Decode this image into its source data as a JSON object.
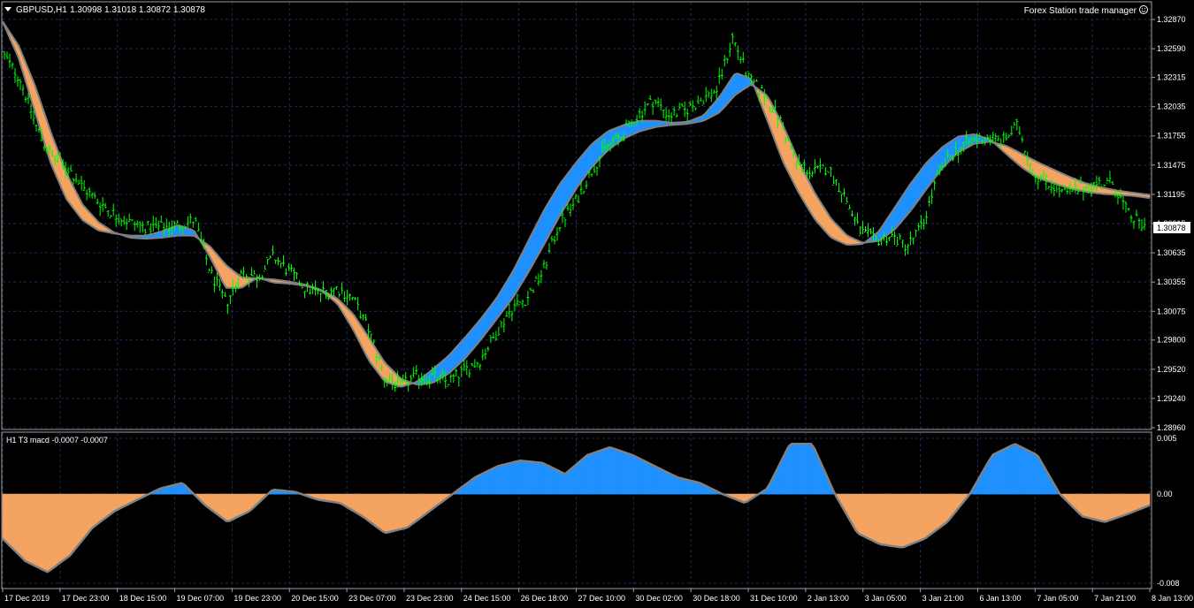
{
  "header": {
    "symbol": "GBPUSD,H1",
    "ohlc": "1.30998 1.31018 1.30872 1.30878",
    "trade_manager": "Forex Station trade manager"
  },
  "colors": {
    "background": "#000000",
    "candle": "#00ff00",
    "up_fill": "#1e90ff",
    "down_fill": "#f4a460",
    "line": "#808080",
    "grid": "#1e2a5a",
    "price_label_bg": "#ffffff"
  },
  "icons": {
    "menu": "triangle-down-icon",
    "trade_manager": "smiley-icon"
  },
  "chart_data": [
    {
      "type": "line",
      "panel": "price",
      "ylim": [
        1.2896,
        1.3287
      ],
      "yticks": [
        "1.32870",
        "1.32590",
        "1.32315",
        "1.32035",
        "1.31755",
        "1.31475",
        "1.31195",
        "1.30915",
        "1.30635",
        "1.30355",
        "1.30075",
        "1.29800",
        "1.29520",
        "1.29240",
        "1.28960"
      ],
      "current_price": "1.30878",
      "grid": true,
      "series": [
        {
          "values": [
            1.3252,
            1.323,
            1.3185,
            1.3155,
            1.3145,
            1.3125,
            1.3112,
            1.31,
            1.3092,
            1.3088,
            1.3088,
            1.309,
            1.3095,
            1.3045,
            1.3015,
            1.3045,
            1.304,
            1.306,
            1.3045,
            1.303,
            1.3025,
            1.303,
            1.302,
            1.299,
            1.2945,
            1.2935,
            1.2945,
            1.2945,
            1.294,
            1.295,
            1.296,
            1.2985,
            1.301,
            1.302,
            1.3045,
            1.309,
            1.311,
            1.314,
            1.3165,
            1.3175,
            1.3195,
            1.321,
            1.3195,
            1.32,
            1.321,
            1.322,
            1.327,
            1.323,
            1.3215,
            1.319,
            1.315,
            1.314,
            1.3145,
            1.312,
            1.3085,
            1.3075,
            1.308,
            1.307,
            1.309,
            1.314,
            1.316,
            1.317,
            1.3175,
            1.317,
            1.3185,
            1.314,
            1.313,
            1.312,
            1.3125,
            1.313,
            1.313,
            1.31,
            1.3088
          ]
        }
      ],
      "band_fast": [
        1.3285,
        1.325,
        1.32,
        1.315,
        1.3115,
        1.3095,
        1.3085,
        1.3082,
        1.308,
        1.308,
        1.3084,
        1.309,
        1.3085,
        1.306,
        1.303,
        1.303,
        1.304,
        1.3035,
        1.3034,
        1.3032,
        1.3027,
        1.3015,
        1.299,
        1.296,
        1.294,
        1.2935,
        1.294,
        1.2952,
        1.2965,
        1.2982,
        1.3,
        1.302,
        1.3045,
        1.3075,
        1.3105,
        1.313,
        1.315,
        1.3168,
        1.318,
        1.3186,
        1.319,
        1.319,
        1.3188,
        1.3189,
        1.3195,
        1.3213,
        1.3236,
        1.323,
        1.319,
        1.315,
        1.312,
        1.3095,
        1.3078,
        1.3071,
        1.3072,
        1.3084,
        1.3107,
        1.313,
        1.315,
        1.3165,
        1.3175,
        1.3177,
        1.3172,
        1.3158,
        1.3145,
        1.3135,
        1.313,
        1.3125,
        1.3122,
        1.312,
        1.3119,
        1.3118,
        1.3116
      ],
      "band_slow": [
        1.3285,
        1.3262,
        1.3225,
        1.318,
        1.314,
        1.311,
        1.3093,
        1.3083,
        1.3078,
        1.3077,
        1.3078,
        1.308,
        1.308,
        1.307,
        1.3052,
        1.304,
        1.3039,
        1.3038,
        1.3036,
        1.3033,
        1.3028,
        1.302,
        1.3005,
        1.2982,
        1.2958,
        1.2943,
        1.2937,
        1.2939,
        1.2948,
        1.2962,
        1.298,
        1.3,
        1.302,
        1.3045,
        1.3072,
        1.31,
        1.3125,
        1.3146,
        1.3162,
        1.3173,
        1.318,
        1.3184,
        1.3186,
        1.3187,
        1.319,
        1.3198,
        1.3215,
        1.3225,
        1.3214,
        1.3185,
        1.315,
        1.312,
        1.3096,
        1.308,
        1.3073,
        1.3075,
        1.3086,
        1.3104,
        1.3125,
        1.3145,
        1.316,
        1.3168,
        1.317,
        1.3166,
        1.3158,
        1.315,
        1.3143,
        1.3136,
        1.313,
        1.3126,
        1.3123,
        1.3121,
        1.3119
      ]
    },
    {
      "type": "area",
      "panel": "indicator",
      "title": "H1 T3 macd -0.0007 -0.0007",
      "ylim": [
        -0.008,
        0.005
      ],
      "yticks": [
        "0.005",
        "0.00",
        "-0.008"
      ],
      "grid": true,
      "series": [
        {
          "values": [
            -0.004,
            -0.006,
            -0.007,
            -0.0055,
            -0.003,
            -0.0015,
            -0.0005,
            0.0005,
            0.001,
            -0.001,
            -0.0025,
            -0.0015,
            0.0004,
            0.0002,
            -0.0005,
            -0.0008,
            -0.002,
            -0.0035,
            -0.003,
            -0.0015,
            0.0,
            0.0015,
            0.0025,
            0.003,
            0.0028,
            0.0018,
            0.0035,
            0.0042,
            0.0035,
            0.0025,
            0.0015,
            0.001,
            0.0,
            -0.0008,
            0.0005,
            0.0045,
            0.0045,
            0.0,
            -0.0035,
            -0.0045,
            -0.0048,
            -0.004,
            -0.0025,
            0.0,
            0.0035,
            0.0045,
            0.0035,
            0.0,
            -0.002,
            -0.0025,
            -0.0018,
            -0.001
          ]
        }
      ]
    }
  ],
  "xaxis": {
    "labels": [
      "17 Dec 2019",
      "17 Dec 23:00",
      "18 Dec 15:00",
      "19 Dec 07:00",
      "19 Dec 23:00",
      "20 Dec 15:00",
      "23 Dec 07:00",
      "23 Dec 23:00",
      "24 Dec 15:00",
      "26 Dec 18:00",
      "27 Dec 10:00",
      "30 Dec 02:00",
      "30 Dec 18:00",
      "31 Dec 10:00",
      "2 Jan 13:00",
      "3 Jan 05:00",
      "3 Jan 21:00",
      "6 Jan 13:00",
      "7 Jan 05:00",
      "7 Jan 21:00",
      "8 Jan 13:00"
    ]
  }
}
